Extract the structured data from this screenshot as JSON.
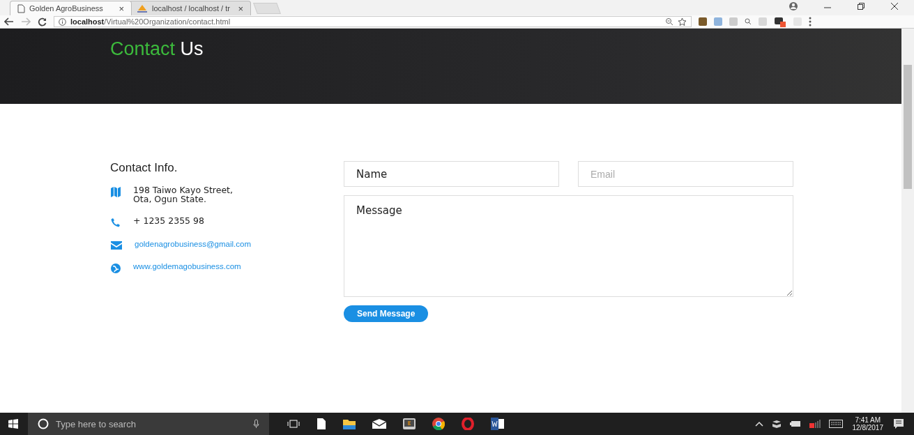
{
  "browser": {
    "tabs": [
      {
        "title": "Golden AgroBusiness",
        "close": "×",
        "selected": true,
        "kind": "page"
      },
      {
        "title": "localhost / localhost / tr",
        "close": "×",
        "selected": false,
        "kind": "pma"
      }
    ],
    "url_host": "localhost",
    "url_path": "/Virtual%20Organization/contact.html"
  },
  "hero": {
    "title_accent": "Contact",
    "title_rest": "Us"
  },
  "contact_info": {
    "heading": "Contact Info.",
    "items": [
      {
        "kind": "map",
        "lines": [
          "198 Taiwo Kayo Street,",
          "Ota, Ogun State."
        ],
        "link": false
      },
      {
        "kind": "phone",
        "lines": [
          "+ 1235 2355 98"
        ],
        "link": false
      },
      {
        "kind": "mail",
        "lines": [
          "goldenagrobusiness@gmail.com"
        ],
        "link": true
      },
      {
        "kind": "globe",
        "lines": [
          "www.goldemagobusiness.com"
        ],
        "link": true
      }
    ]
  },
  "form": {
    "name": {
      "placeholder": "Name"
    },
    "email": {
      "placeholder": "Email"
    },
    "message": {
      "placeholder": "Message"
    },
    "submit": "Send Message"
  },
  "taskbar": {
    "search_placeholder": "Type here to search",
    "time": "7:41 AM",
    "date": "12/8/2017"
  }
}
